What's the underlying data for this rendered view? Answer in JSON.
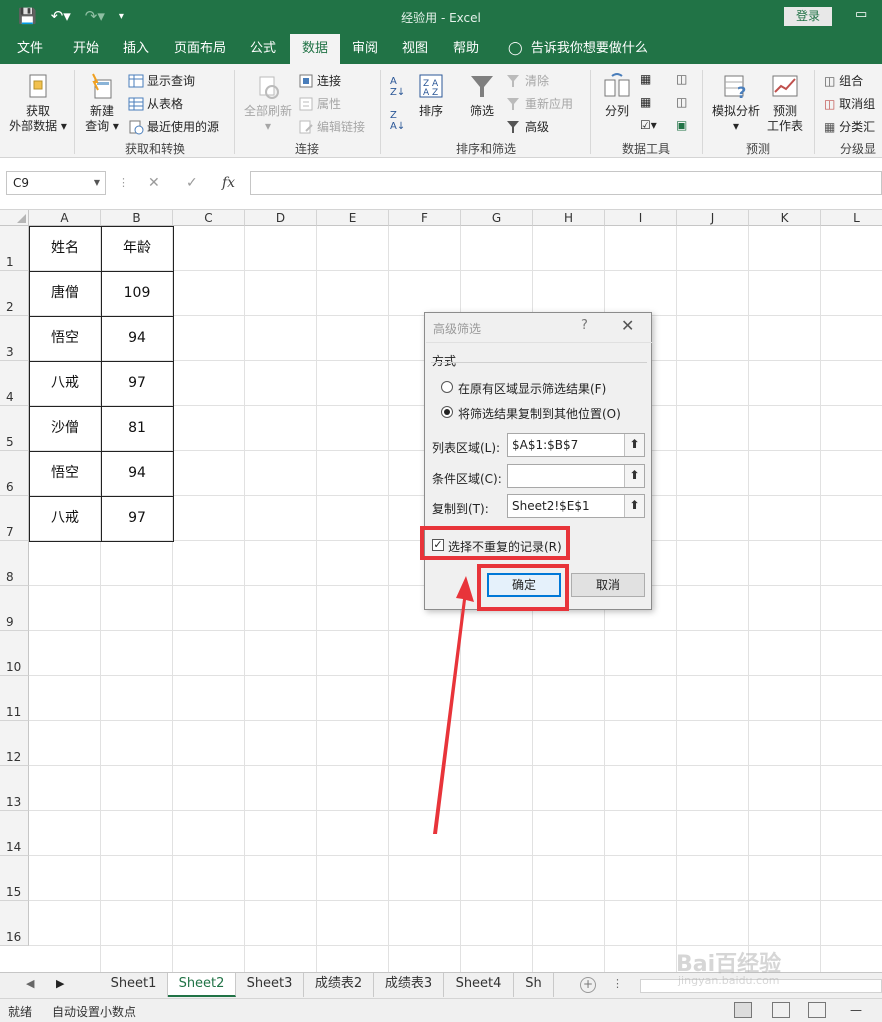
{
  "window": {
    "title": "经验用  -  Excel",
    "login_label": "登录"
  },
  "tabs": [
    "文件",
    "开始",
    "插入",
    "页面布局",
    "公式",
    "数据",
    "审阅",
    "视图",
    "帮助"
  ],
  "active_tab": "数据",
  "tell_me": "告诉我你想要做什么",
  "ribbon": {
    "get_external": [
      "获取",
      "外部数据"
    ],
    "new_query": [
      "新建",
      "查询"
    ],
    "show_query": "显示查询",
    "from_table": "从表格",
    "recent_sources": "最近使用的源",
    "group_get": "获取和转换",
    "refresh_all": "全部刷新",
    "connections": "连接",
    "properties": "属性",
    "edit_links": "编辑链接",
    "group_conn": "连接",
    "sort": "排序",
    "filter": "筛选",
    "clear": "清除",
    "reapply": "重新应用",
    "advanced": "高级",
    "group_sort": "排序和筛选",
    "split": "分列",
    "group_tools": "数据工具",
    "whatif": "模拟分析",
    "forecast": [
      "预测",
      "工作表"
    ],
    "group_forecast": "预测",
    "group_btn": "组合",
    "ungroup": "取消组",
    "subtotal": "分类汇",
    "group_outline": "分级显"
  },
  "formula_bar": {
    "name_box": "C9",
    "fx": "fx",
    "value": ""
  },
  "columns": [
    "A",
    "B",
    "C",
    "D",
    "E",
    "F",
    "G",
    "H",
    "I",
    "J",
    "K",
    "L"
  ],
  "rows": [
    "1",
    "2",
    "3",
    "4",
    "5",
    "6",
    "7",
    "8",
    "9",
    "10",
    "11",
    "12",
    "13",
    "14",
    "15",
    "16"
  ],
  "table": {
    "header": [
      "姓名",
      "年龄"
    ],
    "rows": [
      [
        "唐僧",
        "109"
      ],
      [
        "悟空",
        "94"
      ],
      [
        "八戒",
        "97"
      ],
      [
        "沙僧",
        "81"
      ],
      [
        "悟空",
        "94"
      ],
      [
        "八戒",
        "97"
      ]
    ]
  },
  "dialog": {
    "title": "高级筛选",
    "help": "?",
    "section": "方式",
    "option1": "在原有区域显示筛选结果(F)",
    "option2": "将筛选结果复制到其他位置(O)",
    "list_range_label": "列表区域(L):",
    "list_range": "$A$1:$B$7",
    "criteria_label": "条件区域(C):",
    "criteria": "",
    "copy_to_label": "复制到(T):",
    "copy_to": "Sheet2!$E$1",
    "unique_label": "选择不重复的记录(R)",
    "ok": "确定",
    "cancel": "取消"
  },
  "sheets": [
    "Sheet1",
    "Sheet2",
    "Sheet3",
    "成绩表2",
    "成绩表3",
    "Sheet4",
    "Sh"
  ],
  "active_sheet": "Sheet2",
  "status": {
    "ready": "就绪",
    "auto_decimal": "自动设置小数点"
  },
  "watermark": {
    "main": "Bai百经验",
    "sub": "jingyan.baidu.com"
  },
  "colors": {
    "brand": "#217346",
    "highlight": "#e8343a",
    "dialog_focus": "#0078d7"
  }
}
